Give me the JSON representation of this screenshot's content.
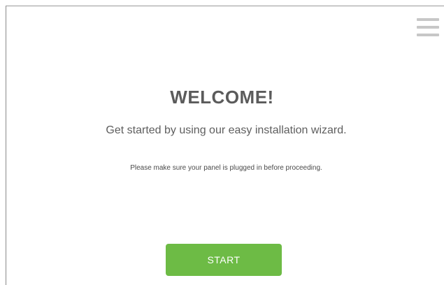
{
  "header": {
    "menu_icon": "hamburger-menu-icon"
  },
  "welcome": {
    "title": "WELCOME!",
    "subtitle": "Get started by using our easy installation wizard.",
    "note": "Please make sure your panel is plugged in before proceeding."
  },
  "actions": {
    "start_label": "START"
  },
  "colors": {
    "accent": "#6dbb45",
    "menu_icon": "#c7c7c7",
    "title_text": "#5b5b5b",
    "background": "#ffffff"
  }
}
